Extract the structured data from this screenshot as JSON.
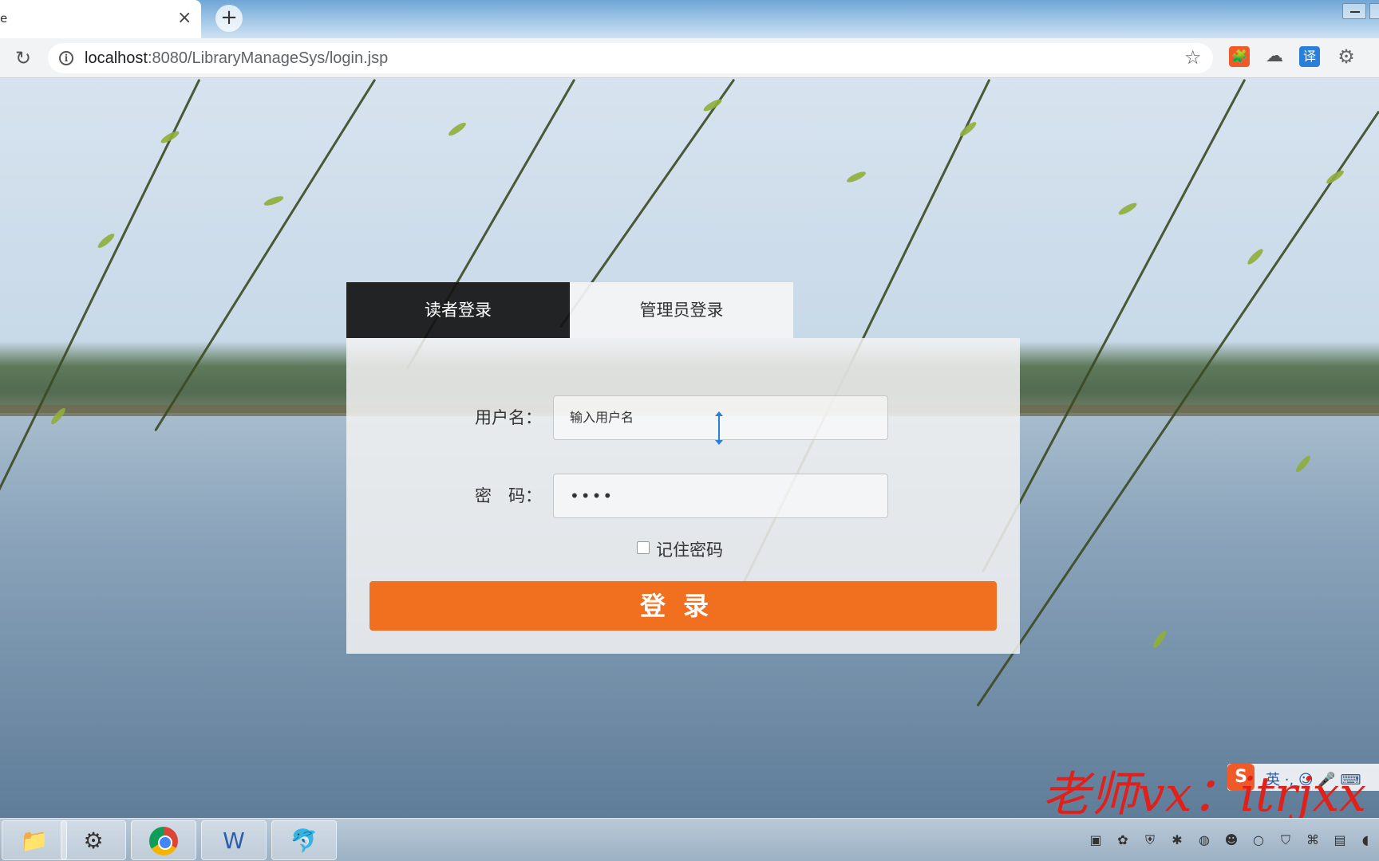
{
  "browser": {
    "tab_title": "e",
    "tab_close": "×",
    "new_tab": "+",
    "reload": "↻",
    "url_host": "localhost",
    "url_rest": ":8080/LibraryManageSys/login.jsp",
    "star": "☆",
    "extensions": [
      "🧩",
      "☁",
      "译",
      "⚙"
    ]
  },
  "login": {
    "tabs": [
      {
        "label": "读者登录",
        "active": true
      },
      {
        "label": "管理员登录",
        "active": false
      }
    ],
    "username_label": "用户名：",
    "username_placeholder": "输入用户名",
    "password_label": "密　码：",
    "password_value": "••••",
    "remember_label": "记住密码",
    "submit_label": "登录"
  },
  "overlay": {
    "ime_logo": "S",
    "ime_text": "英 ·, ☺ 🎤 ⌨",
    "watermark": "老师vx：itrjxx"
  },
  "taskbar": {
    "apps": [
      {
        "name": "file-explorer",
        "glyph": "📁"
      },
      {
        "name": "java-ee-ide",
        "glyph": "⚙"
      },
      {
        "name": "chrome",
        "glyph": ""
      },
      {
        "name": "word",
        "glyph": "W"
      },
      {
        "name": "mysql",
        "glyph": "🐬"
      }
    ],
    "tray_icons": [
      "▣",
      "✿",
      "⛨",
      "✱",
      "◍",
      "☻",
      "○",
      "⛉",
      "⌘",
      "▤",
      "◖"
    ]
  },
  "colors": {
    "accent": "#f07020",
    "active_tab_bg": "#141414",
    "panel_bg": "#f2f2f2",
    "watermark": "#e0201a"
  }
}
